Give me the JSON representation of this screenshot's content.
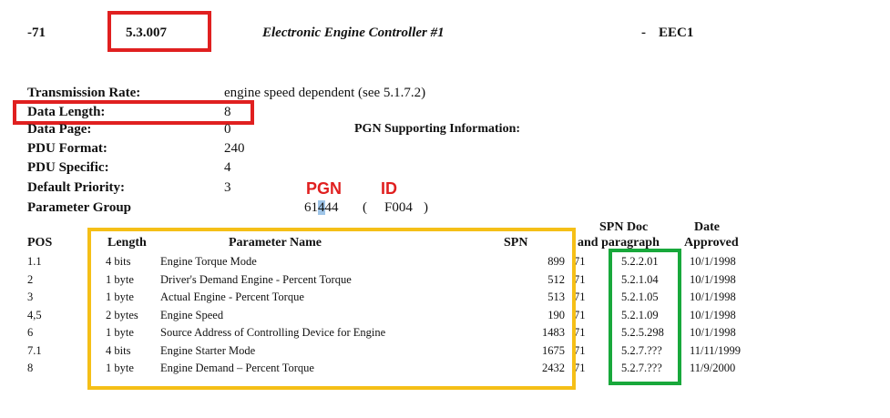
{
  "header": {
    "number": "-71",
    "paragraph": "5.3.007",
    "title": "Electronic Engine Controller #1",
    "dash": "-",
    "abbrev": "EEC1"
  },
  "fields": {
    "transmission_rate": {
      "label": "Transmission Rate:",
      "value": "engine speed dependent (see 5.1.7.2)"
    },
    "data_length": {
      "label": "Data Length:",
      "value": "8"
    },
    "data_page": {
      "label": "Data Page:",
      "value": "0"
    },
    "pdu_format": {
      "label": "PDU Format:",
      "value": "240"
    },
    "pdu_specific": {
      "label": "PDU Specific:",
      "value": "4"
    },
    "default_priority": {
      "label": "Default Priority:",
      "value": "3"
    },
    "parameter_group": {
      "label": "Parameter Group",
      "pgn_pre": "61",
      "pgn_highlight": "4",
      "pgn_post": "44",
      "open_paren": "(",
      "id_value": "F004",
      "close_paren": ")"
    }
  },
  "pgn_supporting_info": "PGN Supporting Information:",
  "annotations": {
    "pgn": "PGN",
    "id": "ID",
    "red_color": "#e02020",
    "yellow_color": "#f5bf17",
    "green_color": "#18a83b"
  },
  "table": {
    "headers": {
      "pos": "POS",
      "length": "Length",
      "name": "Parameter Name",
      "spn": "SPN",
      "spn_doc_1": "SPN Doc",
      "spn_doc_2": "and paragraph",
      "date_1": "Date",
      "date_2": "Approved"
    },
    "rows": [
      {
        "pos": "1.1",
        "length": "4 bits",
        "name": "Engine Torque Mode",
        "spn": "899",
        "doc": "71",
        "para": "5.2.2.01",
        "date": "10/1/1998"
      },
      {
        "pos": "2",
        "length": "1 byte",
        "name": "Driver's Demand Engine - Percent Torque",
        "spn": "512",
        "doc": "71",
        "para": "5.2.1.04",
        "date": "10/1/1998"
      },
      {
        "pos": "3",
        "length": "1 byte",
        "name": "Actual Engine - Percent Torque",
        "spn": "513",
        "doc": "71",
        "para": "5.2.1.05",
        "date": "10/1/1998"
      },
      {
        "pos": "4,5",
        "length": "2 bytes",
        "name": "Engine Speed",
        "spn": "190",
        "doc": "71",
        "para": "5.2.1.09",
        "date": "10/1/1998"
      },
      {
        "pos": "6",
        "length": "1 byte",
        "name": "Source Address of Controlling Device for Engine",
        "spn": "1483",
        "doc": "71",
        "para": "5.2.5.298",
        "date": "10/1/1998"
      },
      {
        "pos": "7.1",
        "length": "4 bits",
        "name": "Engine Starter Mode",
        "spn": "1675",
        "doc": "71",
        "para": "5.2.7.???",
        "date": "11/11/1999"
      },
      {
        "pos": "8",
        "length": "1 byte",
        "name": "Engine Demand – Percent Torque",
        "spn": "2432",
        "doc": "71",
        "para": "5.2.7.???",
        "date": "11/9/2000"
      }
    ]
  }
}
